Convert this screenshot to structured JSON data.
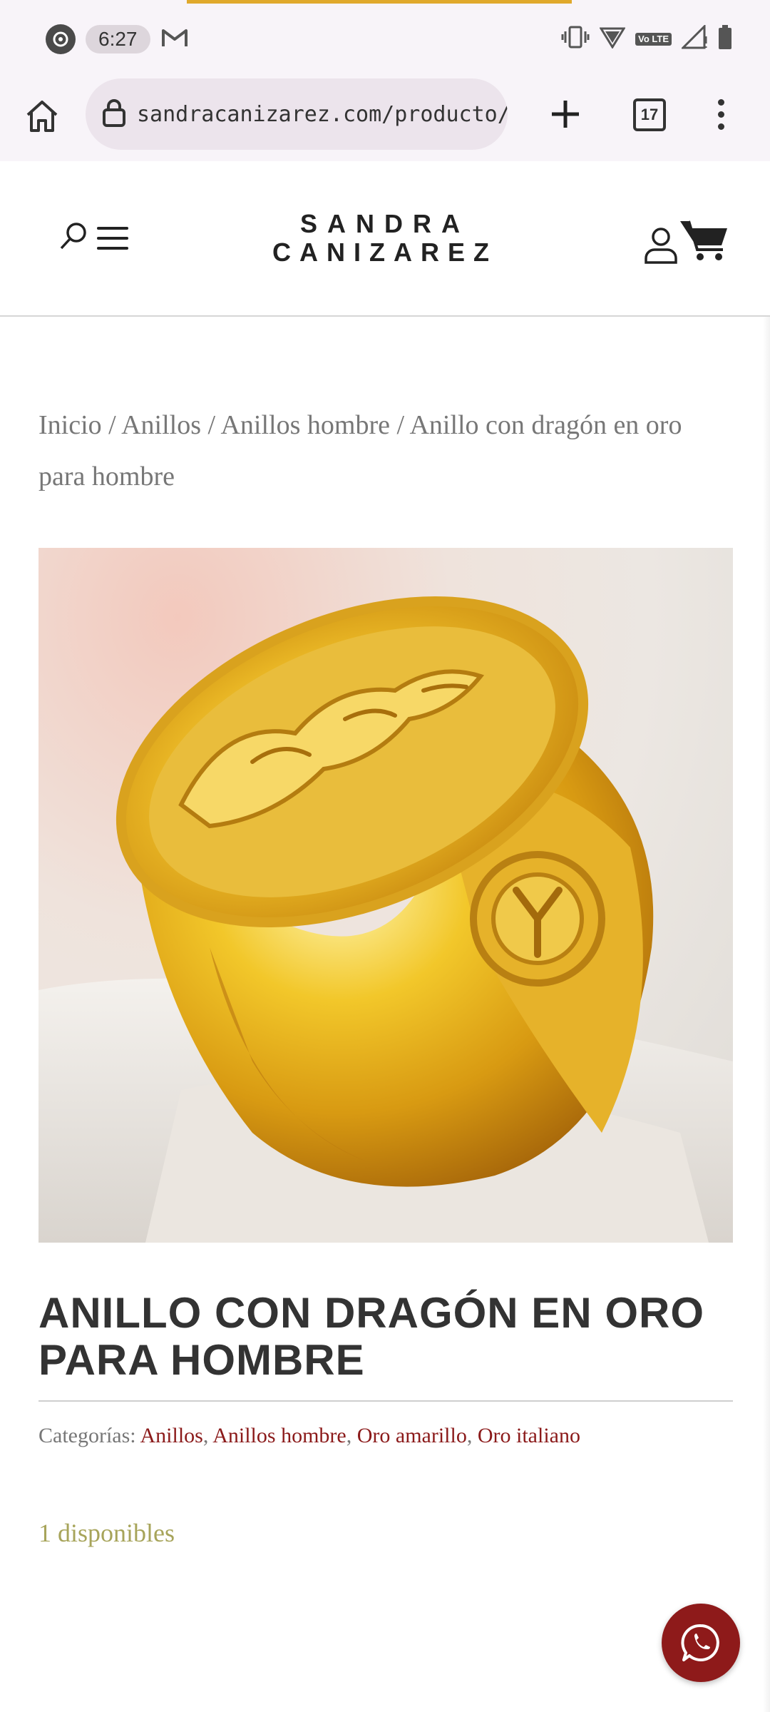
{
  "status_bar": {
    "time": "6:27",
    "icons": [
      "alarm-icon",
      "gmail-icon",
      "vibrate-icon",
      "wifi-icon",
      "volte-icon",
      "signal-icon",
      "battery-icon"
    ],
    "volte_label": "Vo LTE"
  },
  "browser": {
    "url": "sandracanizarez.com/producto/c",
    "tab_count": "17"
  },
  "header": {
    "logo_line1": "SANDRA",
    "logo_line2": "CANIZAREZ"
  },
  "breadcrumb": {
    "items": [
      "Inicio",
      "Anillos",
      "Anillos hombre",
      "Anillo con dragón en oro para hombre"
    ],
    "separator": "/"
  },
  "product": {
    "title": "ANILLO CON DRAGÓN EN ORO PARA HOMBRE",
    "categories_label": "Categorías:",
    "categories": [
      "Anillos",
      "Anillos hombre",
      "Oro amarillo",
      "Oro italiano"
    ],
    "stock": "1 disponibles"
  },
  "colors": {
    "accent": "#8e1a1a",
    "link": "#8b1a1a",
    "stock": "#a7a45a",
    "loading_bar": "#e0a92c"
  }
}
